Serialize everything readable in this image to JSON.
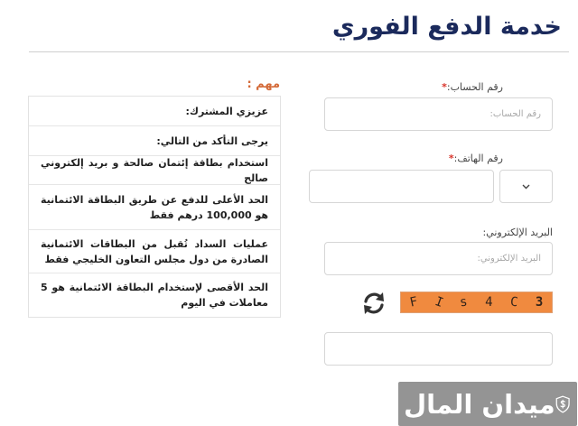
{
  "header": {
    "title": "خدمة الدفع الفوري"
  },
  "form": {
    "account": {
      "label": "رقم الحساب:",
      "required": "*",
      "placeholder": "رقم الحساب:"
    },
    "phone": {
      "label": "رقم الهاتف:",
      "required": "*",
      "select_icon": "chevron-down-icon"
    },
    "email": {
      "label": "البريد الإلكتروني:",
      "placeholder": "البريد الإلكتروني:"
    },
    "captcha": {
      "chars": [
        "3",
        "C",
        "4",
        "s",
        "I",
        "F"
      ],
      "refresh_icon": "refresh-icon"
    }
  },
  "notice": {
    "title": "مهم :",
    "rows": [
      "عزيزي المشترك:",
      "يرجى التأكد من التالي:",
      "استخدام بطاقة إئتمان صالحة و بريد إلكتروني صالح",
      "الحد الأعلى للدفع عن طريق البطاقة الائتمانية هو 100,000 درهم فقط",
      "عمليات السداد تُقبل من البطاقات الائتمانية الصادرة من دول مجلس التعاون الخليجي فقط",
      "الحد الأقصى لإستخدام البطاقة الائتمانية هو 5 معاملات في اليوم"
    ]
  },
  "watermark": {
    "text": "ميدان المال",
    "icon": "shield-money-icon"
  },
  "colors": {
    "title": "#1b2a5c",
    "accent": "#d46a38",
    "required": "#d9342b",
    "captcha_bg": "#f08a3f"
  }
}
